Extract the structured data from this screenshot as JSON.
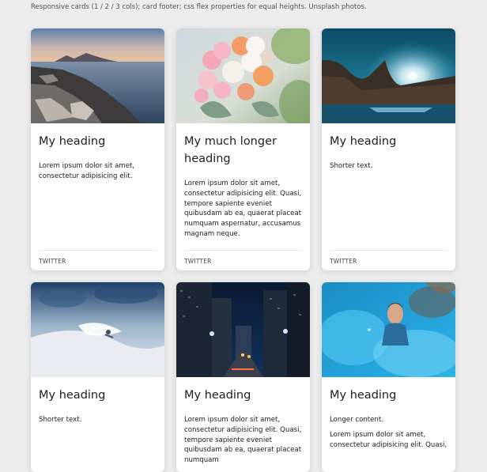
{
  "caption": "Responsive cards (1 / 2 / 3 cols); card footer; css flex properties for equal heights. Unsplash photos.",
  "cards": [
    {
      "image": "coastal-rocks-sunset-photo",
      "heading": "My heading",
      "text": "Lorem ipsum dolor sit amet, consectetur adipisicing elit.",
      "footer": "TWITTER"
    },
    {
      "image": "flower-bouquet-photo",
      "heading": "My much longer heading",
      "text": "Lorem ipsum dolor sit amet, consectetur adipisicing elit. Quasi, tempore sapiente eveniet quibusdam ab ea, quaerat placeat numquam aspernatur, accusamus magnam neque.",
      "footer": "TWITTER"
    },
    {
      "image": "valley-sunburst-river-photo",
      "heading": "My heading",
      "text": "Shorter text.",
      "footer": "TWITTER"
    },
    {
      "image": "snow-mountain-skier-photo",
      "heading": "My heading",
      "text": "Shorter text."
    },
    {
      "image": "city-street-night-photo",
      "heading": "My heading",
      "text": "Lorem ipsum dolor sit amet, consectetur adipisicing elit. Quasi, tempore sapiente eveniet quibusdam ab ea, quaerat placeat numquam"
    },
    {
      "image": "person-blue-smoke-photo",
      "heading": "My heading",
      "text": "Longer content.",
      "text2": "Lorem ipsum dolor sit amet, consectetur adipisicing elit. Quasi,"
    }
  ]
}
